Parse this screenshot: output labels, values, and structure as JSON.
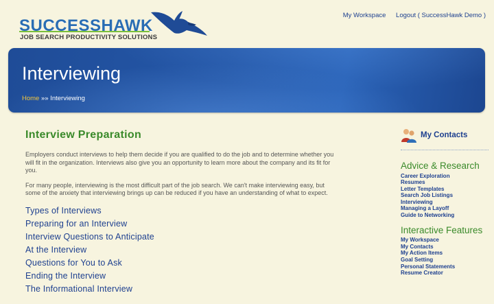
{
  "header": {
    "logo_text": "SUCCESSHAWK",
    "logo_tagline": "JOB SEARCH PRODUCTIVITY SOLUTIONS",
    "links": [
      "My Workspace",
      "Logout ( SuccessHawk Demo )"
    ]
  },
  "banner": {
    "title": "Interviewing",
    "breadcrumb_home": "Home",
    "breadcrumb_sep": " »» ",
    "breadcrumb_current": "Interviewing"
  },
  "main": {
    "heading": "Interview Preparation",
    "paragraphs": [
      "Employers conduct interviews to help them decide if you are qualified to do the job and to determine whether you will fit in the organization. Interviews also give you an opportunity to learn more about the company and its fit for you.",
      "For many people, interviewing is the most difficult part of the job search. We can't make interviewing easy, but some of the anxiety that interviewing brings up can be reduced if you have an understanding of what to expect."
    ],
    "links": [
      "Types of Interviews",
      "Preparing for an Interview",
      "Interview Questions to Anticipate",
      "At the Interview",
      "Questions for You to Ask",
      "Ending the Interview",
      "The Informational Interview"
    ]
  },
  "sidebar": {
    "contacts_label": "My Contacts",
    "sections": [
      {
        "heading": "Advice & Research",
        "items": [
          "Career Exploration",
          "Resumes",
          "Letter Templates",
          "Search Job Listings",
          "Interviewing",
          "Managing a Layoff",
          "Guide to Networking"
        ]
      },
      {
        "heading": "Interactive Features",
        "items": [
          "My Workspace",
          "My Contacts",
          "My Action Items",
          "Goal Setting",
          "Personal Statements",
          "Resume Creator"
        ]
      }
    ]
  },
  "colors": {
    "page_bg": "#f7f4df",
    "banner_blue": "#2457a8",
    "link_blue": "#1d3f8f",
    "heading_green": "#3a8a2a",
    "breadcrumb_gold": "#f2c53d"
  },
  "icons": [
    "hawk-logo-icon",
    "contacts-people-icon"
  ]
}
